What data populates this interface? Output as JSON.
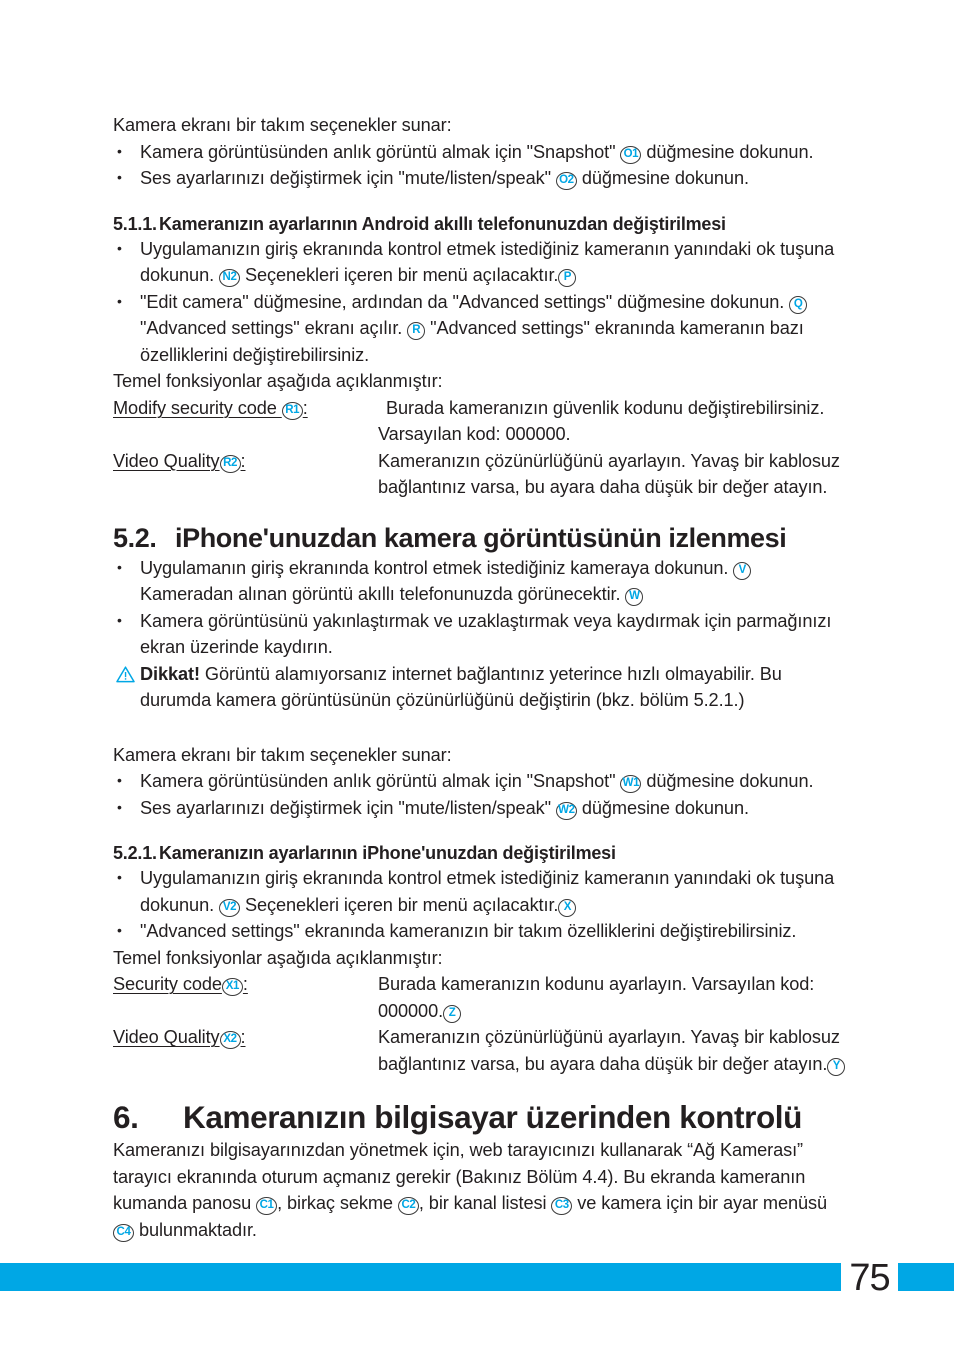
{
  "document": {
    "page_number": "75",
    "accent_color": "#00a7e5",
    "text_color": "#231f20"
  },
  "section_5_1_options": {
    "intro": "Kamera ekranı bir takım seçenekler sunar:",
    "bullets": [
      {
        "before": "Kamera görüntüsünden anlık görüntü almak için \"Snapshot\" ",
        "marker": "O1",
        "after": " düğmesine dokunun."
      },
      {
        "before": "Ses ayarlarınızı değiştirmek için \"mute/listen/speak\" ",
        "marker": "O2",
        "after": " düğmesine dokunun."
      }
    ]
  },
  "section_5_1_1": {
    "number": "5.1.1.",
    "title": "Kameranızın ayarlarının Android akıllı telefonunuzdan değiştirilmesi",
    "bullets": [
      {
        "part1": "Uygulamanızın giriş ekranında kontrol etmek istediğiniz kameranın yanındaki ok tuşuna dokunun. ",
        "marker1": "N2",
        "part2": " Seçenekleri içeren bir menü açılacaktır.",
        "marker2": "P",
        "part3": ""
      },
      {
        "part1": "\"Edit camera\" düğmesine, ardından da \"Advanced settings\" düğmesine dokunun. ",
        "marker1": "Q",
        "part2": " \"Advanced settings\" ekranı açılır. ",
        "marker2": "R",
        "part3": " \"Advanced settings\" ekranında kameranın bazı özelliklerini değiştirebilirsiniz."
      }
    ],
    "functions_intro": "Temel fonksiyonlar aşağıda açıklanmıştır:",
    "definitions": [
      {
        "term": "Modify security code ",
        "marker": "R1",
        "term_suffix": ":",
        "description": "Burada kameranızın güvenlik kodunu değiştirebilirsiniz. Varsayılan kod: 000000."
      },
      {
        "term": "Video Quality",
        "marker": "R2",
        "term_suffix": ":",
        "description": "Kameranızın çözünürlüğünü ayarlayın. Yavaş bir kablosuz bağlantınız varsa, bu ayara daha düşük bir değer atayın."
      }
    ]
  },
  "section_5_2": {
    "number": "5.2.",
    "title": "iPhone'unuzdan kamera görüntüsünün izlenmesi",
    "bullets": [
      {
        "part1": "Uygulamanın giriş ekranında kontrol etmek istediğiniz kameraya dokunun. ",
        "marker1": "V",
        "part2": " Kameradan alınan görüntü akıllı telefonunuzda görünecektir. ",
        "marker2": "W",
        "part3": ""
      },
      {
        "part1": "Kamera görüntüsünü yakınlaştırmak ve uzaklaştırmak veya kaydırmak için parmağınızı ekran üzerinde kaydırın.",
        "marker1": "",
        "part2": "",
        "marker2": "",
        "part3": ""
      }
    ],
    "warning": {
      "icon": "warning-triangle-icon",
      "label": "Dikkat!",
      "text": " Görüntü alamıyorsanız internet bağlantınız yeterince hızlı olmayabilir. Bu durumda kamera görüntüsünün çözünürlüğünü değiştirin (bkz. bölüm 5.2.1.)"
    }
  },
  "section_5_2_options": {
    "intro": "Kamera ekranı bir takım seçenekler sunar:",
    "bullets": [
      {
        "before": "Kamera görüntüsünden anlık görüntü almak için \"Snapshot\" ",
        "marker": "W1",
        "after": " düğmesine dokunun."
      },
      {
        "before": "Ses ayarlarınızı değiştirmek için \"mute/listen/speak\" ",
        "marker": "W2",
        "after": " düğmesine dokunun."
      }
    ]
  },
  "section_5_2_1": {
    "number": "5.2.1.",
    "title": "Kameranızın ayarlarının iPhone'unuzdan değiştirilmesi",
    "bullets": [
      {
        "part1": "Uygulamanızın giriş ekranında kontrol etmek istediğiniz kameranın yanındaki ok tuşuna dokunun. ",
        "marker1": "V2",
        "part2": " Seçenekleri içeren bir menü açılacaktır.",
        "marker2": "X",
        "part3": ""
      },
      {
        "part1": "\"Advanced settings\" ekranında kameranızın bir takım özelliklerini değiştirebilirsiniz.",
        "marker1": "",
        "part2": "",
        "marker2": "",
        "part3": ""
      }
    ],
    "functions_intro": "Temel fonksiyonlar aşağıda açıklanmıştır:",
    "definitions": [
      {
        "term": "Security code",
        "marker": "X1",
        "term_suffix": ":",
        "desc_part1": "Burada kameranızın kodunu ayarlayın. Varsayılan kod: 000000.",
        "desc_marker": "Z",
        "desc_part2": ""
      },
      {
        "term": "Video Quality",
        "marker": "X2",
        "term_suffix": ":",
        "desc_part1": "Kameranızın çözünürlüğünü ayarlayın. Yavaş bir kablosuz bağlantınız varsa, bu ayara daha düşük bir değer atayın.",
        "desc_marker": "Y",
        "desc_part2": ""
      }
    ]
  },
  "section_6": {
    "number": "6.",
    "title": "Kameranızın bilgisayar üzerinden kontrolü",
    "paragraph": {
      "part1": "Kameranızı bilgisayarınızdan yönetmek için, web tarayıcınızı kullanarak “Ağ Kamerası” tarayıcı ekranında oturum açmanız gerekir (Bakınız Bölüm 4.4). Bu ekranda kameranın kumanda panosu ",
      "marker1": "C1",
      "part2": ", birkaç sekme ",
      "marker2": "C2",
      "part3": ", bir kanal listesi ",
      "marker3": "C3",
      "part4": " ve kamera için bir ayar menüsü ",
      "marker4": "C4",
      "part5": " bulunmaktadır."
    }
  }
}
